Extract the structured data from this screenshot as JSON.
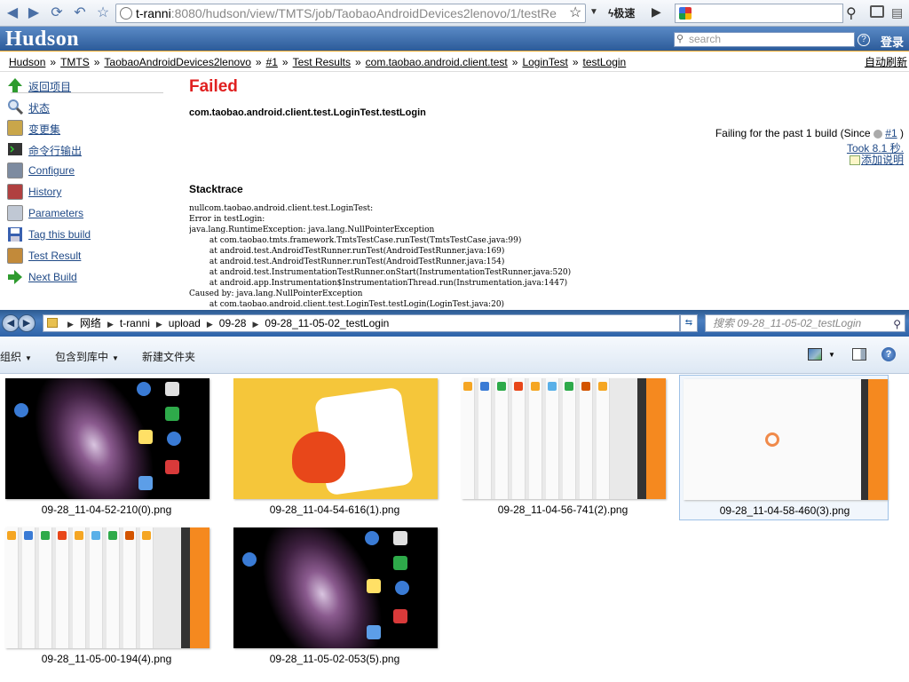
{
  "browser": {
    "url_host": "t-ranni",
    "url_rest": ":8080/hudson/view/TMTS/job/TaobaoAndroidDevices2lenovo/1/testRe",
    "speed_label": "极速"
  },
  "header": {
    "logo": "Hudson",
    "search_placeholder": "search",
    "login": "登录"
  },
  "breadcrumb": {
    "items": [
      "Hudson",
      "TMTS",
      "TaobaoAndroidDevices2lenovo",
      "#1",
      "Test Results",
      "com.taobao.android.client.test",
      "LoginTest",
      "testLogin"
    ],
    "separator": "»",
    "auto_refresh": "自动刷新"
  },
  "sidebar": {
    "items": [
      {
        "label": "返回项目",
        "icon": "arrow-up-icon",
        "color": "#2e9b2e"
      },
      {
        "label": "状态",
        "icon": "magnifier-icon",
        "color": "#6b8fbf"
      },
      {
        "label": "变更集",
        "icon": "notepad-icon",
        "color": "#c9a64a"
      },
      {
        "label": "命令行输出",
        "icon": "terminal-icon",
        "color": "#333333"
      },
      {
        "label": "Configure",
        "icon": "tools-icon",
        "color": "#7d8ba0"
      },
      {
        "label": "History",
        "icon": "history-icon",
        "color": "#b04040"
      },
      {
        "label": "Parameters",
        "icon": "document-icon",
        "color": "#c0c8d4"
      },
      {
        "label": "Tag this build",
        "icon": "floppy-icon",
        "color": "#3860b0"
      },
      {
        "label": "Test Result",
        "icon": "clipboard-icon",
        "color": "#c28a3a"
      },
      {
        "label": "Next Build",
        "icon": "arrow-right-icon",
        "color": "#2e9b2e"
      }
    ]
  },
  "main": {
    "status": "Failed",
    "test_full_name": "com.taobao.android.client.test.LoginTest.testLogin",
    "failing_prefix": "Failing for the past 1 build (Since",
    "failing_build": "#1",
    "failing_suffix": ")",
    "took": "Took 8.1 秒.",
    "add_description": "添加说明",
    "stacktrace_title": "Stacktrace",
    "stacktrace": "nullcom.taobao.android.client.test.LoginTest:\nError in testLogin:\njava.lang.RuntimeException: java.lang.NullPointerException\n\tat com.taobao.tmts.framework.TmtsTestCase.runTest(TmtsTestCase.java:99)\n\tat android.test.AndroidTestRunner.runTest(AndroidTestRunner.java:169)\n\tat android.test.AndroidTestRunner.runTest(AndroidTestRunner.java:154)\n\tat android.test.InstrumentationTestRunner.onStart(InstrumentationTestRunner.java:520)\n\tat android.app.Instrumentation$InstrumentationThread.run(Instrumentation.java:1447)\nCaused by: java.lang.NullPointerException\n\tat com.taobao.android.client.test.LoginTest.testLogin(LoginTest.java:20)"
  },
  "explorer": {
    "path": [
      "网络",
      "t-ranni",
      "upload",
      "09-28",
      "09-28_11-05-02_testLogin"
    ],
    "search_placeholder": "搜索 09-28_11-05-02_testLogin",
    "commands": {
      "organize": "组织",
      "include_library": "包含到库中",
      "new_folder": "新建文件夹"
    },
    "files": [
      {
        "name": "09-28_11-04-52-210(0).png",
        "kind": "galaxy",
        "selected": false
      },
      {
        "name": "09-28_11-04-54-616(1).png",
        "kind": "taobao",
        "selected": false
      },
      {
        "name": "09-28_11-04-56-741(2).png",
        "kind": "applist",
        "selected": false
      },
      {
        "name": "09-28_11-04-58-460(3).png",
        "kind": "blank",
        "selected": true
      },
      {
        "name": "09-28_11-05-00-194(4).png",
        "kind": "applist",
        "selected": false
      },
      {
        "name": "09-28_11-05-02-053(5).png",
        "kind": "galaxy",
        "selected": false
      }
    ]
  }
}
